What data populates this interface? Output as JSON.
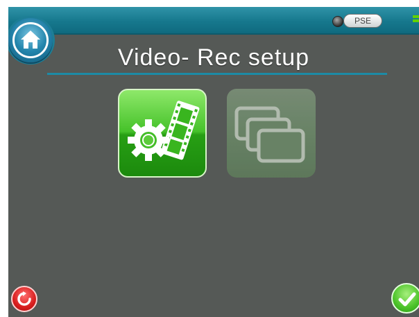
{
  "header": {
    "title": "Video- Rec setup",
    "pse_label": "PSE",
    "battery_level": 1.0
  },
  "tiles": [
    {
      "name": "video-settings",
      "enabled": true
    },
    {
      "name": "multi-screen",
      "enabled": false
    }
  ],
  "footer": {
    "left_icon": "reset-icon",
    "right_icon": "checkmark-icon"
  },
  "colors": {
    "screen_background": "#555956",
    "topbar": "#16788d",
    "accent_green": "#46c22a",
    "reset_red": "#d81e1e"
  }
}
